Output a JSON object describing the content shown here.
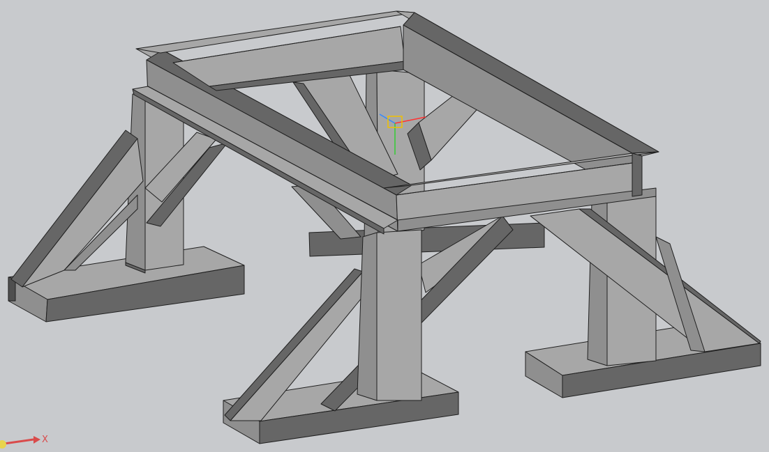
{
  "viewport": {
    "background": "#c8cacd"
  },
  "model": {
    "colors": {
      "light": "#a7a7a7",
      "mid": "#8f8f8f",
      "dark": "#666666",
      "darker": "#4f4f4f",
      "edge": "#1f1f1f"
    }
  },
  "origin_gizmo": {
    "x_color": "#ff3333",
    "y_color": "#33cc33",
    "z_color": "#3388ff",
    "box_color": "#f0c000"
  },
  "triad": {
    "x_label": "X",
    "x_color": "#d94b4b",
    "origin_color": "#e8d44d"
  }
}
